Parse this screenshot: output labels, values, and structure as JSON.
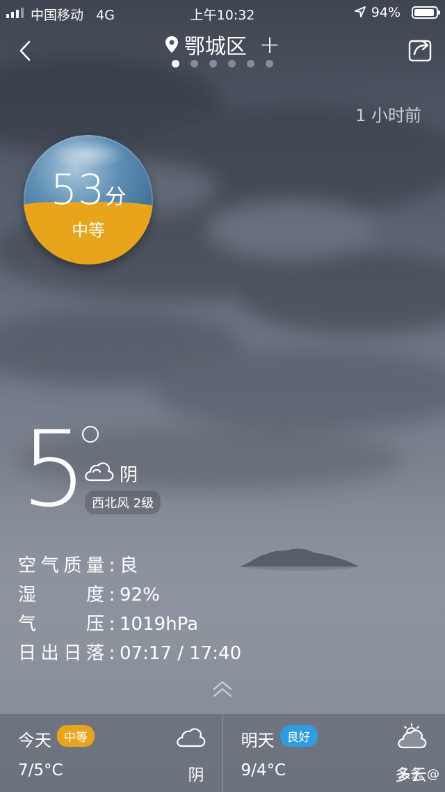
{
  "status_bar": {
    "carrier": "中国移动",
    "network": "4G",
    "time": "上午10:32",
    "battery": "94%"
  },
  "header": {
    "city": "鄂城区",
    "updated": "1 小时前"
  },
  "aqi": {
    "score": "53",
    "unit": "分",
    "level": "中等"
  },
  "current": {
    "temperature": "5",
    "condition": "阴",
    "wind": "西北风 2级"
  },
  "details": [
    {
      "label_chars": [
        "空",
        "气",
        "质",
        "量"
      ],
      "value": "良"
    },
    {
      "label_chars": [
        "湿",
        "度"
      ],
      "value": "92%"
    },
    {
      "label_chars": [
        "气",
        "压"
      ],
      "value": "1019hPa"
    },
    {
      "label_chars": [
        "日",
        "出",
        "日",
        "落"
      ],
      "value": "07:17 / 17:40"
    }
  ],
  "forecast": {
    "today": {
      "label": "今天",
      "badge": "中等",
      "temp": "7/5°C",
      "cond": "阴"
    },
    "tomorrow": {
      "label": "明天",
      "badge": "良好",
      "temp": "9/4°C",
      "cond": "多云"
    }
  },
  "credit": "头条 @"
}
